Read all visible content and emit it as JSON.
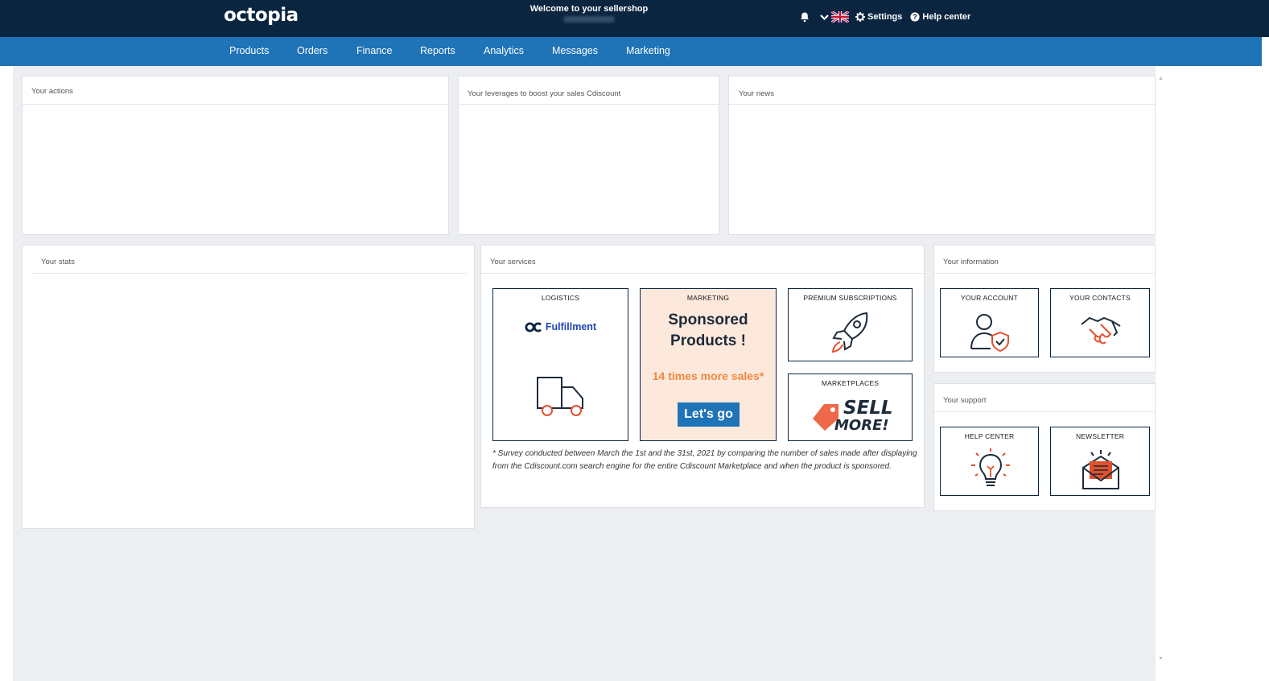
{
  "header": {
    "logo": "octopia",
    "welcome": "Welcome to your sellershop",
    "settings_label": "Settings",
    "help_label": "Help center"
  },
  "nav": {
    "items": [
      "Products",
      "Orders",
      "Finance",
      "Reports",
      "Analytics",
      "Messages",
      "Marketing"
    ]
  },
  "panels": {
    "actions": "Your actions",
    "leverages": "Your leverages to boost your sales Cdiscount",
    "news": "Your news",
    "stats": "Your stats",
    "services": "Your services",
    "information": "Your information",
    "support": "Your support"
  },
  "services": {
    "logistics": {
      "label": "LOGISTICS",
      "brand": "Fulfillment"
    },
    "marketing": {
      "label": "MARKETING",
      "title_line1": "Sponsored",
      "title_line2": "Products !",
      "times": "14 times more sales*",
      "button": "Let's go"
    },
    "premium": {
      "label": "PREMIUM SUBSCRIPTIONS"
    },
    "marketplaces": {
      "label": "MARKETPLACES",
      "sell": "SELL",
      "more": "MORE!"
    },
    "survey": "* Survey conducted between March the 1st and the 31st, 2021 by comparing the number of sales made after displaying from the Cdiscount.com search engine for the entire Cdiscount Marketplace and when the product is sponsored."
  },
  "information": {
    "account": "YOUR ACCOUNT",
    "contacts": "YOUR CONTACTS"
  },
  "support": {
    "help": "HELP CENTER",
    "newsletter": "NEWSLETTER"
  },
  "colors": {
    "topbar": "#0a2540",
    "navbar": "#1f73b7",
    "accent_orange": "#f1883e",
    "marketing_bg": "#fde8dc",
    "icon_red": "#e2502d"
  }
}
